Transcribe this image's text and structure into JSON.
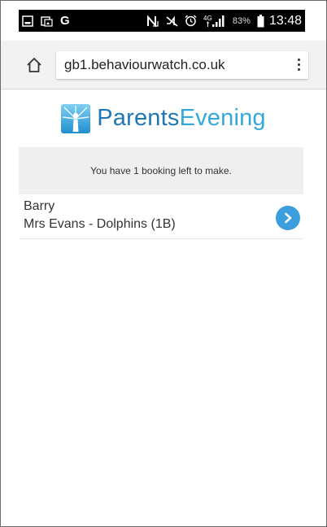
{
  "status_bar": {
    "left_icons": [
      "gallery-icon",
      "screenshot-icon",
      "google-icon"
    ],
    "right_icons": [
      "nfc-icon",
      "mute-icon",
      "alarm-icon",
      "4g-signal-icon",
      "battery-icon"
    ],
    "google_glyph": "G",
    "network": "4G",
    "battery": "83%",
    "time": "13:48"
  },
  "browser": {
    "url": "gb1.behaviourwatch.co.uk"
  },
  "logo": {
    "word1": "Parents",
    "word2": "Evening"
  },
  "notice": {
    "text": "You have 1 booking left to make."
  },
  "booking": {
    "name": "Barry",
    "teacher_class": "Mrs Evans - Dolphins (1B)"
  },
  "colors": {
    "brand_dark": "#1f77b6",
    "brand_light": "#35a8dc",
    "button_blue": "#3a9fdc"
  }
}
